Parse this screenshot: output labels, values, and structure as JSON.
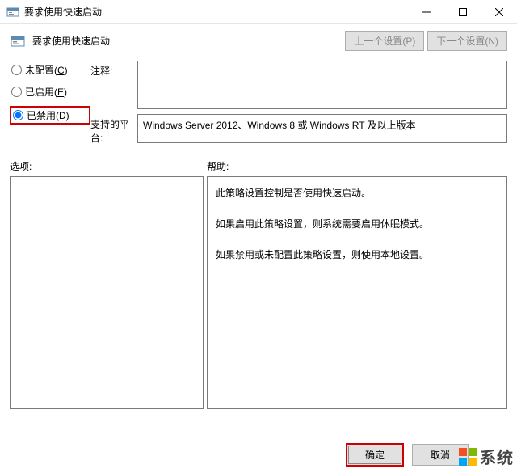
{
  "titlebar": {
    "title": "要求使用快速启动"
  },
  "header": {
    "policy_name": "要求使用快速启动",
    "prev_button": "上一个设置(P)",
    "next_button": "下一个设置(N)"
  },
  "radios": {
    "not_configured": "未配置(C)",
    "enabled": "已启用(E)",
    "disabled": "已禁用(D)",
    "selected": "disabled"
  },
  "fields": {
    "comment_label": "注释:",
    "comment_value": "",
    "platform_label": "支持的平台:",
    "platform_value": "Windows Server 2012、Windows 8 或 Windows RT 及以上版本"
  },
  "lower": {
    "options_label": "选项:",
    "help_label": "帮助:",
    "help_lines": [
      "此策略设置控制是否使用快速启动。",
      "如果启用此策略设置，则系统需要启用休眠模式。",
      "如果禁用或未配置此策略设置，则使用本地设置。"
    ]
  },
  "buttons": {
    "ok": "确定",
    "cancel": "取消"
  },
  "watermark": {
    "text": "系统"
  }
}
